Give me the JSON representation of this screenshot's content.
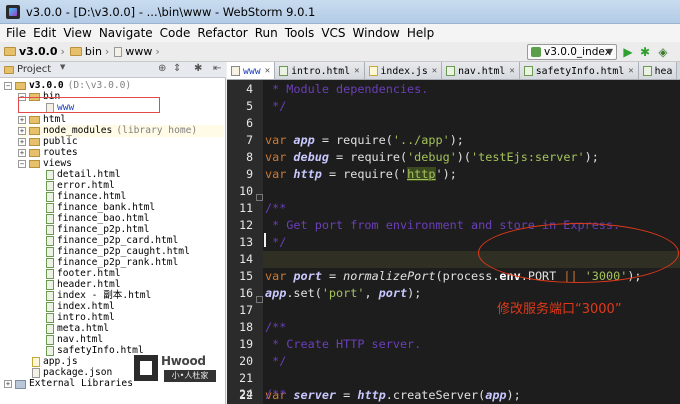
{
  "window": {
    "title": "v3.0.0 - [D:\\v3.0.0] - ...\\bin\\www - WebStorm 9.0.1"
  },
  "menu": [
    "File",
    "Edit",
    "View",
    "Navigate",
    "Code",
    "Refactor",
    "Run",
    "Tools",
    "VCS",
    "Window",
    "Help"
  ],
  "breadcrumb": {
    "project": "v3.0.0",
    "folder": "bin",
    "file": "www"
  },
  "run_config": {
    "label": "v3.0.0_index"
  },
  "project_panel": {
    "title": "Project",
    "tree": {
      "root": "v3.0.0",
      "root_path": "(D:\\v3.0.0)",
      "bin": "bin",
      "www": "www",
      "html": "html",
      "node_modules": "node_modules",
      "node_modules_note": "(library home)",
      "public": "public",
      "routes": "routes",
      "views": "views",
      "view_files": [
        "detail.html",
        "error.html",
        "finance.html",
        "finance_bank.html",
        "finance_bao.html",
        "finance_p2p.html",
        "finance_p2p_card.html",
        "finance_p2p_caught.html",
        "finance_p2p_rank.html",
        "footer.html",
        "header.html",
        "index - 副本.html",
        "index.html",
        "intro.html",
        "meta.html",
        "nav.html",
        "safetyInfo.html"
      ],
      "app_js": "app.js",
      "package_json": "package.json",
      "external_libraries": "External Libraries"
    }
  },
  "tabs": [
    "www",
    "intro.html",
    "index.js",
    "nav.html",
    "safetyInfo.html",
    "hea"
  ],
  "editor": {
    "line_numbers": [
      "4",
      "5",
      "6",
      "7",
      "8",
      "9",
      "10",
      "11",
      "12",
      "13",
      "14",
      "15",
      "16",
      "17",
      "18",
      "19",
      "20",
      "21",
      "22",
      "23",
      "24"
    ],
    "code": {
      "l4": " * Module dependencies.",
      "l5": " */",
      "l7_var": "var ",
      "l7_name": "app",
      "l7_mid": " = require(",
      "l7_str": "'../app'",
      "l7_end": ");",
      "l8_var": "var ",
      "l8_name": "debug",
      "l8_mid": " = require(",
      "l8_str": "'debug'",
      "l8_mid2": ")(",
      "l8_str2": "'testEjs:server'",
      "l8_end": ");",
      "l9_var": "var ",
      "l9_name": "http",
      "l9_mid": " = require('",
      "l9_str": "http",
      "l9_end": "');",
      "l11": "/**",
      "l12": " * Get port from environment and store in Express.",
      "l13": " */",
      "l15_var": "var ",
      "l15_name": "port",
      "l15_eq": " = ",
      "l15_fn": "normalizePort",
      "l15_mid": "(process.",
      "l15_env": "env",
      "l15_mid2": ".PORT ",
      "l15_or": "||",
      "l15_sp": " ",
      "l15_str": "'3000'",
      "l15_end": ");",
      "l16_app": "app",
      "l16_mid": ".set(",
      "l16_str": "'port'",
      "l16_c": ", ",
      "l16_port": "port",
      "l16_end": ");",
      "l18": "/**",
      "l19": " * Create HTTP server.",
      "l20": " */",
      "l22_var": "var ",
      "l22_name": "server",
      "l22_eq": " = ",
      "l22_http": "http",
      "l22_mid": ".createServer(",
      "l22_app": "app",
      "l22_end": ");",
      "l24": "/**"
    }
  },
  "annotation": {
    "text": "修改服务端口“3000”",
    "color": "#e0391a"
  },
  "watermark": {
    "brand": "Hwood",
    "sub": "小•人杜家"
  }
}
